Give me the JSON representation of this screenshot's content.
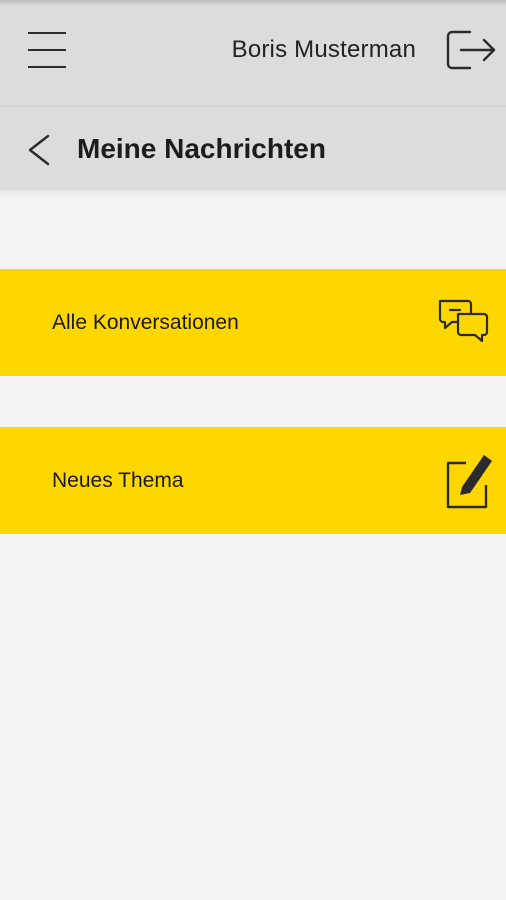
{
  "header": {
    "user_name": "Boris Musterman",
    "menu_icon": "hamburger-menu-icon",
    "logout_icon": "logout-icon"
  },
  "page": {
    "title": "Meine Nachrichten",
    "back_icon": "back-chevron-icon"
  },
  "menu_items": [
    {
      "label": "Alle Konversationen",
      "icon": "chat-bubbles-icon"
    },
    {
      "label": "Neues Thema",
      "icon": "edit-note-icon"
    }
  ],
  "colors": {
    "header_bg": "#dcdcdc",
    "accent_yellow": "#ffd700",
    "page_bg": "#f5f5f5",
    "text_dark": "#1c1c1c"
  }
}
